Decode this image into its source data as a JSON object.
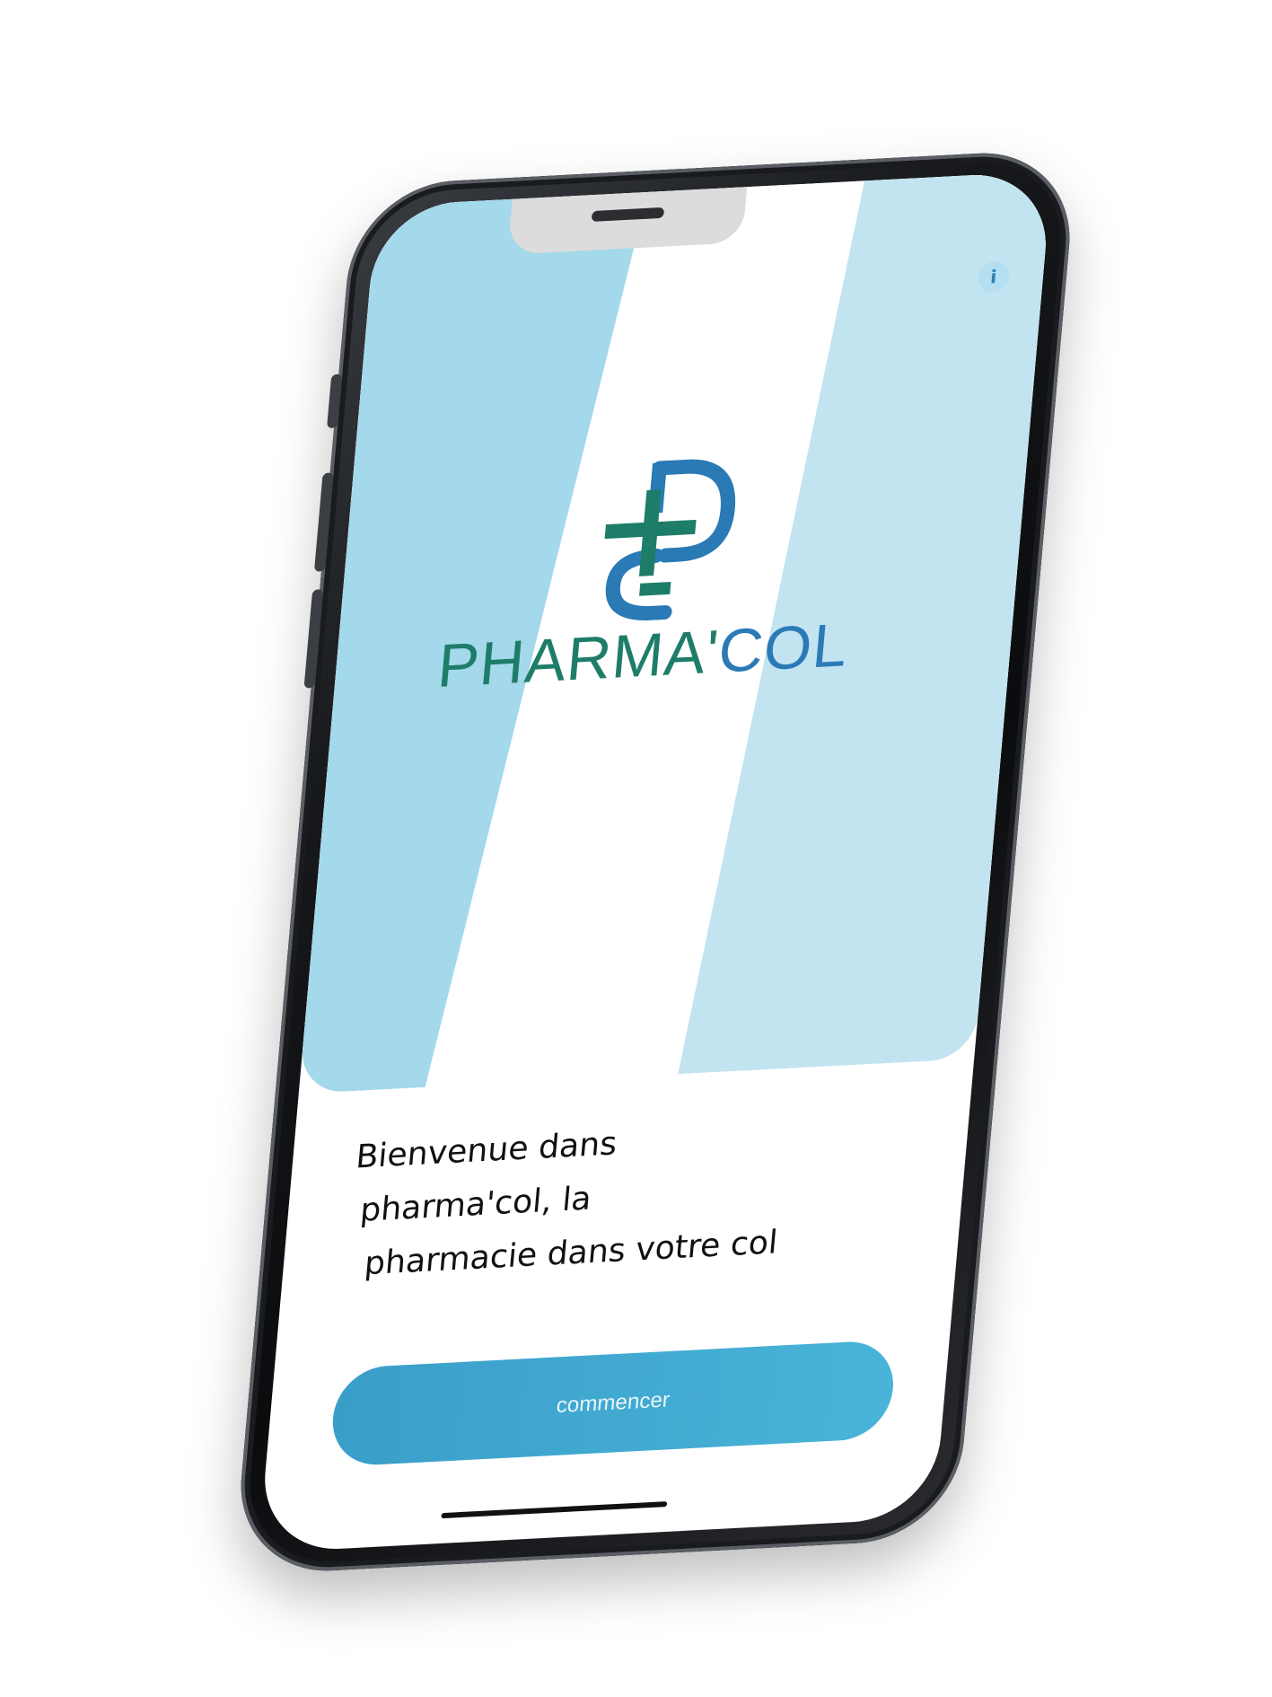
{
  "app": {
    "logo_text_part1": "PHARMA'",
    "logo_text_part2": "COL",
    "info_label": "i"
  },
  "welcome": {
    "line1": "Bienvenue dans",
    "line2": "pharma'col, la",
    "line3": "pharmacie dans votre col"
  },
  "actions": {
    "start_label": "commencer"
  },
  "colors": {
    "hero_blue": "#a4d8eb",
    "hero_blue_light": "#c2e4f1",
    "button": "#3fa9d2",
    "logo_green": "#1e7d68",
    "logo_blue": "#2a7ab6"
  }
}
